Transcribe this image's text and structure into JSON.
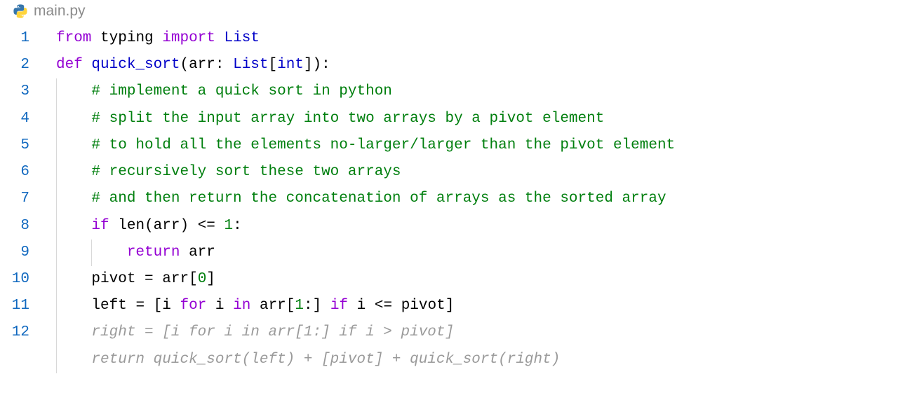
{
  "tab": {
    "filename": "main.py",
    "language": "python"
  },
  "colors": {
    "keyword": "#9400d3",
    "builtin": "#0000c8",
    "comment": "#007f0e",
    "linenum": "#1068bf",
    "ghost": "#9a9a9a",
    "text": "#000000"
  },
  "editor": {
    "current_line": 12,
    "lines": [
      {
        "n": 1,
        "indent": 0,
        "tokens": [
          {
            "t": "from",
            "c": "kw"
          },
          {
            "t": " ",
            "c": "sp"
          },
          {
            "t": "typing",
            "c": "id"
          },
          {
            "t": " ",
            "c": "sp"
          },
          {
            "t": "import",
            "c": "kw"
          },
          {
            "t": " ",
            "c": "sp"
          },
          {
            "t": "List",
            "c": "builtin"
          }
        ]
      },
      {
        "n": 2,
        "indent": 0,
        "tokens": [
          {
            "t": "def",
            "c": "kw"
          },
          {
            "t": " ",
            "c": "sp"
          },
          {
            "t": "quick_sort",
            "c": "func"
          },
          {
            "t": "(",
            "c": "punct"
          },
          {
            "t": "arr",
            "c": "id"
          },
          {
            "t": ":",
            "c": "punct"
          },
          {
            "t": " ",
            "c": "sp"
          },
          {
            "t": "List",
            "c": "builtin"
          },
          {
            "t": "[",
            "c": "punct"
          },
          {
            "t": "int",
            "c": "builtin"
          },
          {
            "t": "]",
            "c": "punct"
          },
          {
            "t": ")",
            "c": "punct"
          },
          {
            "t": ":",
            "c": "punct"
          }
        ]
      },
      {
        "n": 3,
        "indent": 1,
        "tokens": [
          {
            "t": "# implement a quick sort in python",
            "c": "comment"
          }
        ]
      },
      {
        "n": 4,
        "indent": 1,
        "tokens": [
          {
            "t": "# split the input array into two arrays by a pivot element",
            "c": "comment"
          }
        ]
      },
      {
        "n": 5,
        "indent": 1,
        "tokens": [
          {
            "t": "# to hold all the elements no-larger/larger than the pivot element",
            "c": "comment"
          }
        ]
      },
      {
        "n": 6,
        "indent": 1,
        "tokens": [
          {
            "t": "# recursively sort these two arrays",
            "c": "comment"
          }
        ]
      },
      {
        "n": 7,
        "indent": 1,
        "tokens": [
          {
            "t": "# and then return the concatenation of arrays as the sorted array",
            "c": "comment"
          }
        ]
      },
      {
        "n": 8,
        "indent": 1,
        "tokens": [
          {
            "t": "if",
            "c": "kw"
          },
          {
            "t": " ",
            "c": "sp"
          },
          {
            "t": "len",
            "c": "id"
          },
          {
            "t": "(",
            "c": "punct"
          },
          {
            "t": "arr",
            "c": "id"
          },
          {
            "t": ")",
            "c": "punct"
          },
          {
            "t": " ",
            "c": "sp"
          },
          {
            "t": "<=",
            "c": "op"
          },
          {
            "t": " ",
            "c": "sp"
          },
          {
            "t": "1",
            "c": "num"
          },
          {
            "t": ":",
            "c": "punct"
          }
        ]
      },
      {
        "n": 9,
        "indent": 2,
        "tokens": [
          {
            "t": "return",
            "c": "kw"
          },
          {
            "t": " ",
            "c": "sp"
          },
          {
            "t": "arr",
            "c": "id"
          }
        ]
      },
      {
        "n": 10,
        "indent": 1,
        "tokens": [
          {
            "t": "pivot",
            "c": "id"
          },
          {
            "t": " ",
            "c": "sp"
          },
          {
            "t": "=",
            "c": "op"
          },
          {
            "t": " ",
            "c": "sp"
          },
          {
            "t": "arr",
            "c": "id"
          },
          {
            "t": "[",
            "c": "punct"
          },
          {
            "t": "0",
            "c": "num"
          },
          {
            "t": "]",
            "c": "punct"
          }
        ]
      },
      {
        "n": 11,
        "indent": 1,
        "tokens": [
          {
            "t": "left",
            "c": "id"
          },
          {
            "t": " ",
            "c": "sp"
          },
          {
            "t": "=",
            "c": "op"
          },
          {
            "t": " ",
            "c": "sp"
          },
          {
            "t": "[",
            "c": "punct"
          },
          {
            "t": "i",
            "c": "id"
          },
          {
            "t": " ",
            "c": "sp"
          },
          {
            "t": "for",
            "c": "kw"
          },
          {
            "t": " ",
            "c": "sp"
          },
          {
            "t": "i",
            "c": "id"
          },
          {
            "t": " ",
            "c": "sp"
          },
          {
            "t": "in",
            "c": "kw"
          },
          {
            "t": " ",
            "c": "sp"
          },
          {
            "t": "arr",
            "c": "id"
          },
          {
            "t": "[",
            "c": "punct"
          },
          {
            "t": "1",
            "c": "num"
          },
          {
            "t": ":",
            "c": "punct"
          },
          {
            "t": "]",
            "c": "punct"
          },
          {
            "t": " ",
            "c": "sp"
          },
          {
            "t": "if",
            "c": "kw"
          },
          {
            "t": " ",
            "c": "sp"
          },
          {
            "t": "i",
            "c": "id"
          },
          {
            "t": " ",
            "c": "sp"
          },
          {
            "t": "<=",
            "c": "op"
          },
          {
            "t": " ",
            "c": "sp"
          },
          {
            "t": "pivot",
            "c": "id"
          },
          {
            "t": "]",
            "c": "punct"
          }
        ]
      },
      {
        "n": 12,
        "indent": 1,
        "ghost": true,
        "current": true,
        "tokens": [
          {
            "t": "right = [i for i in arr[1:] if i > pivot]",
            "c": "ghost"
          }
        ]
      },
      {
        "n": null,
        "indent": 1,
        "ghost": true,
        "tokens": [
          {
            "t": "return quick_sort(left) + [pivot] + quick_sort(right)",
            "c": "ghost"
          }
        ]
      }
    ]
  }
}
